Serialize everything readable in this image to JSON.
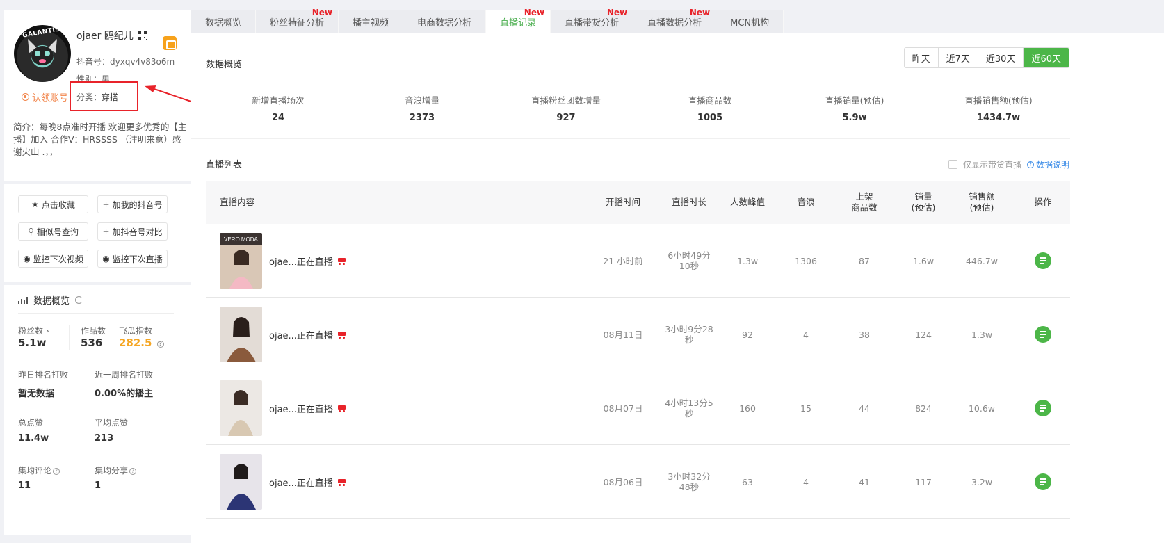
{
  "profile": {
    "nickname": "ojaer 鸥纪儿",
    "avatar_text": "GALANTIS",
    "douyin_id": "抖音号：dyxqv4v83o6m",
    "gender": "性别：男",
    "certify": "认领账号",
    "category_label": "分类：",
    "category_value": "穿搭",
    "bio": "简介：每晚8点准时开播 欢迎更多优秀的【主播】加入 合作V：HRSSSS （注明来意）感谢火山 .，，"
  },
  "actions": [
    {
      "label": "点击收藏",
      "icon": "star-icon",
      "glyph": "★"
    },
    {
      "label": "加我的抖音号",
      "icon": "plus-icon",
      "glyph": "+"
    },
    {
      "label": "相似号查询",
      "icon": "search-icon",
      "glyph": "⚲"
    },
    {
      "label": "加抖音号对比",
      "icon": "plus-icon",
      "glyph": "+"
    },
    {
      "label": "监控下次视频",
      "icon": "eye-icon",
      "glyph": "◉"
    },
    {
      "label": "监控下次直播",
      "icon": "eye-icon",
      "glyph": "◉"
    }
  ],
  "stats": {
    "title": "数据概览",
    "fans_label": "粉丝数",
    "fans": "5.1w",
    "works_label": "作品数",
    "works": "536",
    "index_label": "飞瓜指数",
    "index": "282.5",
    "rank_yesterday_label": "昨日排名打败",
    "rank_yesterday": "暂无数据",
    "rank_week_label": "近一周排名打败",
    "rank_week": "0.00%的播主",
    "likes_label": "总点赞",
    "likes": "11.4w",
    "avg_likes_label": "平均点赞",
    "avg_likes": "213",
    "avg_comment_label": "集均评论",
    "avg_comment": "11",
    "avg_share_label": "集均分享",
    "avg_share": "1"
  },
  "tabs": [
    {
      "label": "数据概览",
      "new": ""
    },
    {
      "label": "粉丝特征分析",
      "new": "New"
    },
    {
      "label": "播主视频",
      "new": ""
    },
    {
      "label": "电商数据分析",
      "new": ""
    },
    {
      "label": "直播记录",
      "new": "New"
    },
    {
      "label": "直播带货分析",
      "new": "New"
    },
    {
      "label": "直播数据分析",
      "new": "New"
    },
    {
      "label": "MCN机构",
      "new": ""
    }
  ],
  "active_tab": "直播记录",
  "overview": {
    "title": "数据概览",
    "ranges": [
      "昨天",
      "近7天",
      "近30天",
      "近60天"
    ],
    "selected_range": "近60天",
    "items": [
      {
        "label": "新增直播场次",
        "value": "24"
      },
      {
        "label": "音浪增量",
        "value": "2373"
      },
      {
        "label": "直播粉丝团数增量",
        "value": "927"
      },
      {
        "label": "直播商品数",
        "value": "1005"
      },
      {
        "label": "直播销量(预估)",
        "value": "5.9w"
      },
      {
        "label": "直播销售额(预估)",
        "value": "1434.7w"
      }
    ]
  },
  "live_list": {
    "title": "直播列表",
    "filter_label": "仅显示带货直播",
    "help_label": "数据说明",
    "columns": [
      "直播内容",
      "开播时间",
      "直播时长",
      "人数峰值",
      "音浪",
      "上架\n商品数",
      "销量\n(预估)",
      "销售额\n(预估)",
      "操作"
    ],
    "rows": [
      {
        "title": "ojae...正在直播",
        "start": "21 小时前",
        "duration": "6小时49分\n10秒",
        "peak": "1.3w",
        "yinlang": "1306",
        "items": "87",
        "sales": "1.6w",
        "amount": "446.7w"
      },
      {
        "title": "ojae...正在直播",
        "start": "08月11日",
        "duration": "3小时9分28\n秒",
        "peak": "92",
        "yinlang": "4",
        "items": "38",
        "sales": "124",
        "amount": "1.3w"
      },
      {
        "title": "ojae...正在直播",
        "start": "08月07日",
        "duration": "4小时13分5\n秒",
        "peak": "160",
        "yinlang": "15",
        "items": "44",
        "sales": "824",
        "amount": "10.6w"
      },
      {
        "title": "ojae...正在直播",
        "start": "08月06日",
        "duration": "3小时32分\n48秒",
        "peak": "63",
        "yinlang": "4",
        "items": "41",
        "sales": "117",
        "amount": "3.2w"
      }
    ]
  },
  "colors": {
    "accent": "#4cb648",
    "new_badge": "#e8232a",
    "index": "#f5a623",
    "cert": "#f2874e",
    "link": "#3e8ee8"
  }
}
